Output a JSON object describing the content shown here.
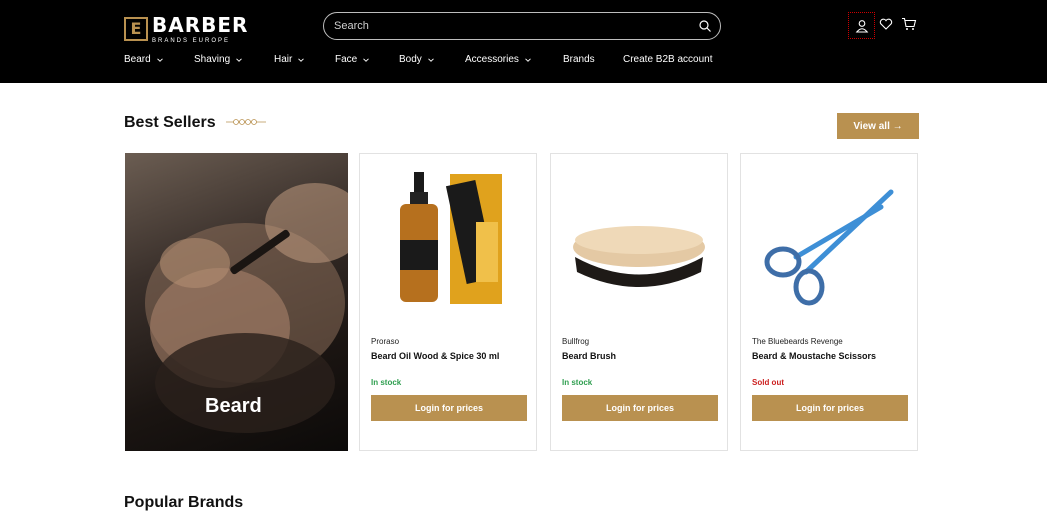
{
  "colors": {
    "accent": "#b99150",
    "header_bg": "#000000",
    "in_stock": "#2e9e4f",
    "sold_out": "#cc1f1f"
  },
  "header": {
    "logo": {
      "word": "BARBER",
      "sub": "BRANDS EUROPE",
      "mark": "E"
    },
    "search": {
      "placeholder": "Search"
    },
    "icons": [
      "account-icon",
      "wishlist-icon",
      "cart-icon"
    ]
  },
  "nav": {
    "items": [
      {
        "label": "Beard",
        "dropdown": true
      },
      {
        "label": "Shaving",
        "dropdown": true
      },
      {
        "label": "Hair",
        "dropdown": true
      },
      {
        "label": "Face",
        "dropdown": true
      },
      {
        "label": "Body",
        "dropdown": true
      },
      {
        "label": "Accessories",
        "dropdown": true
      },
      {
        "label": "Brands",
        "dropdown": false
      },
      {
        "label": "Create B2B account",
        "dropdown": false
      }
    ]
  },
  "best_sellers": {
    "title": "Best Sellers",
    "view_all": "View all →",
    "hero_label": "Beard",
    "products": [
      {
        "brand": "Proraso",
        "title": "Beard Oil Wood & Spice 30 ml",
        "stock": "In stock",
        "button": "Login for prices",
        "image": "beard-oil-bottle"
      },
      {
        "brand": "Bullfrog",
        "title": "Beard Brush",
        "stock": "In stock",
        "button": "Login for prices",
        "image": "beard-brush"
      },
      {
        "brand": "The Bluebeards Revenge",
        "title": "Beard & Moustache Scissors",
        "stock": "Sold out",
        "button": "Login for prices",
        "image": "scissors"
      }
    ]
  },
  "next_section": {
    "title": "Popular Brands"
  }
}
